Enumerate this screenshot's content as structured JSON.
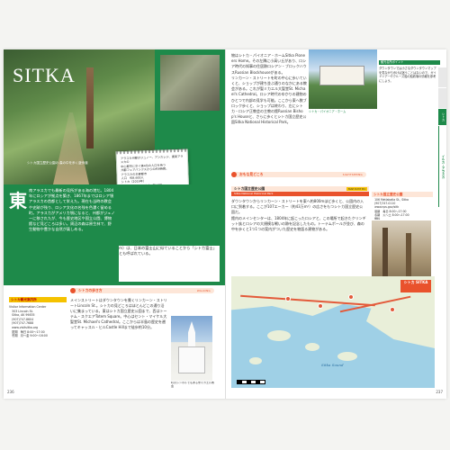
{
  "left": {
    "title": "SITKA",
    "photo_caption": "シトカ国立歴史公園の\n森の中を歩く遊歩道",
    "notebook_text": "アラスカ州都がジュノー、アンカレジ、東南アラスカの\n中心都市に次ぐ第4位の人口を持つ\n州都フェアバンクスからの約9時間。\nアラスカの主要都市\n人口　約8,600人\nシトカ（2019年）\n面積　約4,811km²（一部水域）\n市外局番　907",
    "dropcap": "東",
    "intro_text": "南アラスカでも最新の見所がある海の港だ。1804年にロシアが拠点を築き、1867年まではロシア領アラスカの首都として栄えた。現在も当時の教会や史跡が残り、ロシア文化の名残を色濃く留める町。アラスカがアメリカ領になると、州都がジュノーに移されたが、今も歴史地区や国立公園、博物館など見どころは多い。周辺の森は原生林で、野生動物や豊かな自然が楽しめる。",
    "info_label": "シトカ観光案内所",
    "info_text": "Visitor Information Center\n　303 Lincoln St.\n　Sitka, AK 99835\n　(907)747-8604\n　(907)747-7688\n　www.visitsitka.org\n　夏期　毎日 8:00～17:00\n　冬期　月～金 9:00～16:00",
    "walk_header": "シトカの歩き方",
    "walk_tag": "WALKING",
    "walk_text": "メインストリートはダウンタウンを貫くリンカーン・ストリートLincoln St.。シトカの見どころはほとんどこの通り沿いに集まっている。東はシトカ国立歴史公園まで、西はトーテム・スクエアTotem Square。中心はセント・マイケル大聖堂St. Michael's Cathedral。ここからは半島の歴史を遡ってキャッスル・ヒルCastle Hillまで徒歩約10分。",
    "church_caption": "町のシンボルでもある聖ミカエル教会",
    "page_number": "236",
    "sidenote": "m）は、日本の富士山に似ていることから「シトカ富士」とも呼ばれている。"
  },
  "right": {
    "body_text": "物はシトカ・パイオニア・ホームSitka Pioneers Home。その左隣に小高い丘があり、ロシア時代の知事の住居跡ロシアン・ブロックハウスRussian Blockhouseがある。\nリンカーン・ストリートを町の中心に歩いていくと、ショップが建ち並ぶ通りのなかにある教会がある。これが聖ミカエル大聖堂St. Michael's Cathedral。ロシア時代のゆかりの建物のひとつで内部の見学も可能。ここから東へ数ブロック歩くと、ショップは終わり、左にシトカ・ロシア正教会の主教の館Russian Bishop's Houseと、さらに歩くとシトカ国立歴史公園Sitka National Historical Park。",
    "photo1_caption": "シトカ・パイオニア・ホーム",
    "info_label": "観光名所ポイント",
    "info_text": "ダウンタウンでは小さなダウンタウンマップを見ながら歩けば迷うことはないので、ガイドツアーやクルーズ船の船着場の情報を参考にしよう。",
    "nat_header": "おもな見どころ",
    "nat_tag": "SIGHTSEEING",
    "nat_title": "シトカ国立歴史公園",
    "nat_sub": "Sitka National Historical Park",
    "nat_mapref": "MAP P.237 B1",
    "nat_text": "ダウンタウンからリンカーン・ストリートを東へ約800mほど歩くと、公園内の入口に到着する。ここが107エーカー（約43万m²）の広さをもつシトカ国立歴史公園だ。\n館内のメインセンターは、1804年に起こったロシアと、この場所で起きたクリンギット族とロシアの大規模な戦いの跡を記念したもの。トーテムポールが並び、森の中を歩くと1つ1つの案内がついた歴史を物語る建物がある。",
    "visitor_label": "シトカ国立歴史公園",
    "visitor_text": "　106 Metlakatla St., Sitka\n　(907)747-0110\n　www.nps.gov/sitk\n　夏期　毎日 8:00～17:00\n　冬期　火～土 8:00～17:00\n　無料",
    "museum_caption": "トーテムポールの展示されているビジター・センター",
    "map_city": "シトカ\nSITKA",
    "map_sound": "Sitka Sound",
    "page_number": "237",
    "tabs": [
      "シトカ",
      "イルカ・アラスカ"
    ]
  }
}
